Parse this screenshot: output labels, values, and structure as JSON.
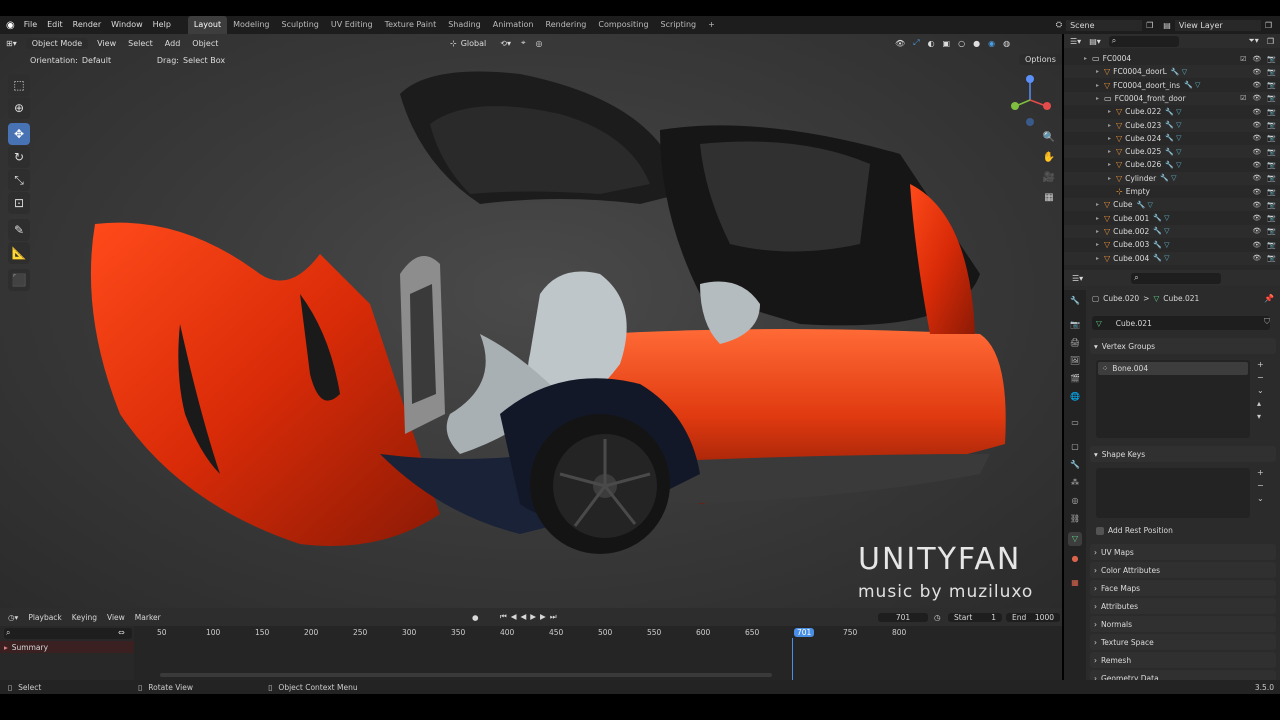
{
  "menu": {
    "items": [
      "File",
      "Edit",
      "Render",
      "Window",
      "Help"
    ]
  },
  "workspaces": [
    "Layout",
    "Modeling",
    "Sculpting",
    "UV Editing",
    "Texture Paint",
    "Shading",
    "Animation",
    "Rendering",
    "Compositing",
    "Scripting"
  ],
  "scene": {
    "name": "Scene",
    "view_layer": "View Layer",
    "plus": "+"
  },
  "viewport": {
    "mode": "Object Mode",
    "view": "View",
    "select": "Select",
    "add": "Add",
    "object": "Object",
    "orientation_label": "Orientation:",
    "orientation_value": "Default",
    "drag_label": "Drag:",
    "drag_value": "Select Box",
    "transform": "Global",
    "options": "Options"
  },
  "watermark": {
    "line1": "UNITYFAN",
    "line2": "music by muziluxo"
  },
  "outliner": {
    "rows": [
      {
        "name": "FC0004",
        "type": "collection",
        "indent": 0
      },
      {
        "name": "FC0004_doorL",
        "type": "object",
        "indent": 1
      },
      {
        "name": "FC0004_doort_ins",
        "type": "object",
        "indent": 1
      },
      {
        "name": "FC0004_front_door",
        "type": "collection",
        "indent": 1
      },
      {
        "name": "Cube.022",
        "type": "object",
        "indent": 2
      },
      {
        "name": "Cube.023",
        "type": "object",
        "indent": 2
      },
      {
        "name": "Cube.024",
        "type": "object",
        "indent": 2
      },
      {
        "name": "Cube.025",
        "type": "object",
        "indent": 2
      },
      {
        "name": "Cube.026",
        "type": "object",
        "indent": 2
      },
      {
        "name": "Cylinder",
        "type": "object",
        "indent": 2
      },
      {
        "name": "Empty",
        "type": "empty",
        "indent": 2
      },
      {
        "name": "Cube",
        "type": "object",
        "indent": 1
      },
      {
        "name": "Cube.001",
        "type": "object",
        "indent": 1
      },
      {
        "name": "Cube.002",
        "type": "object",
        "indent": 1
      },
      {
        "name": "Cube.003",
        "type": "object",
        "indent": 1
      },
      {
        "name": "Cube.004",
        "type": "object",
        "indent": 1
      }
    ]
  },
  "properties": {
    "breadcrumb_object": "Cube.020",
    "breadcrumb_sep": ">",
    "breadcrumb_mesh": "Cube.021",
    "mesh_name": "Cube.021",
    "vertex_groups": "Vertex Groups",
    "vertex_group_item": "Bone.004",
    "shape_keys": "Shape Keys",
    "add_rest_position": "Add Rest Position",
    "panels": [
      "UV Maps",
      "Color Attributes",
      "Face Maps",
      "Attributes",
      "Normals",
      "Texture Space",
      "Remesh",
      "Geometry Data"
    ]
  },
  "timeline": {
    "playback": "Playback",
    "keying": "Keying",
    "view": "View",
    "marker": "Marker",
    "current_frame": "701",
    "start_label": "Start",
    "start": "1",
    "end_label": "End",
    "end": "1000",
    "summary": "Summary",
    "ticks": [
      "50",
      "100",
      "150",
      "200",
      "250",
      "300",
      "350",
      "400",
      "450",
      "500",
      "550",
      "600",
      "650",
      "701",
      "750",
      "800"
    ]
  },
  "status": {
    "select": "Select",
    "rotate": "Rotate View",
    "context": "Object Context Menu",
    "version": "3.5.0"
  }
}
